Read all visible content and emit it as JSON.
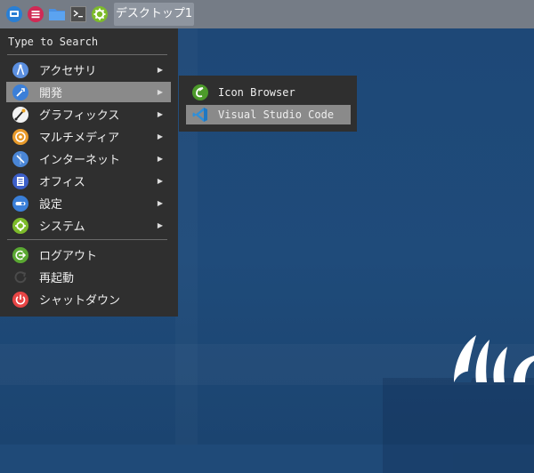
{
  "panel": {
    "workspace_label": "デスクトップ1"
  },
  "menu": {
    "search_label": "Type to Search",
    "items": [
      {
        "label": "アクセサリ",
        "icon": "accessories-icon"
      },
      {
        "label": "開発",
        "icon": "development-icon"
      },
      {
        "label": "グラフィックス",
        "icon": "graphics-icon"
      },
      {
        "label": "マルチメディア",
        "icon": "multimedia-icon"
      },
      {
        "label": "インターネット",
        "icon": "internet-icon"
      },
      {
        "label": "オフィス",
        "icon": "office-icon"
      },
      {
        "label": "設定",
        "icon": "settings-icon"
      },
      {
        "label": "システム",
        "icon": "system-icon"
      }
    ],
    "actions": [
      {
        "label": "ログアウト",
        "icon": "logout-icon"
      },
      {
        "label": "再起動",
        "icon": "restart-icon"
      },
      {
        "label": "シャットダウン",
        "icon": "shutdown-icon"
      }
    ],
    "arrow": "▶"
  },
  "submenu": {
    "items": [
      {
        "label": "Icon Browser",
        "icon": "icon-browser-icon"
      },
      {
        "label": "Visual Studio Code",
        "icon": "vscode-icon"
      }
    ]
  },
  "colors": {
    "panel": "#757c86",
    "menu_bg": "#2f2f2f",
    "highlight": "#8a8a8a",
    "desktop": "#1f4a78"
  }
}
